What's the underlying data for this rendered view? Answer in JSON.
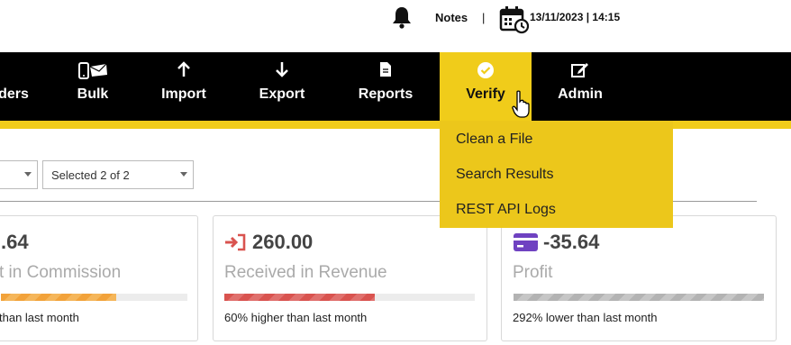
{
  "header": {
    "notes_label": "Notes",
    "separator": "|",
    "datetime": "13/11/2023 | 14:15"
  },
  "nav": {
    "items": [
      {
        "label": "ders",
        "icon": "none"
      },
      {
        "label": "Bulk",
        "icon": "phone-mail-icon"
      },
      {
        "label": "Import",
        "icon": "arrow-up-icon"
      },
      {
        "label": "Export",
        "icon": "arrow-down-icon"
      },
      {
        "label": "Reports",
        "icon": "document-icon"
      },
      {
        "label": "Verify",
        "icon": "check-circle-icon",
        "active": true
      },
      {
        "label": "Admin",
        "icon": "edit-icon"
      }
    ],
    "active_color": "#f0cc1a"
  },
  "dropdown": {
    "items": [
      "Clean a File",
      "Search Results",
      "REST API Logs"
    ]
  },
  "filters": {
    "select_2_value": "Selected 2 of 2"
  },
  "cards": [
    {
      "value": ".64",
      "label": "t in Commission",
      "note": "than last month",
      "fill_fraction": 0.62,
      "color": "#f2a23a"
    },
    {
      "value": "260.00",
      "label": "Received in Revenue",
      "note": "60% higher than last month",
      "fill_fraction": 0.6,
      "color": "#d9534f",
      "icon": "sign-in-icon"
    },
    {
      "value": "-35.64",
      "label": "Profit",
      "note": "292% lower than last month",
      "fill_fraction": 1.0,
      "color": "#b3b3b3",
      "icon": "credit-card-icon"
    }
  ]
}
